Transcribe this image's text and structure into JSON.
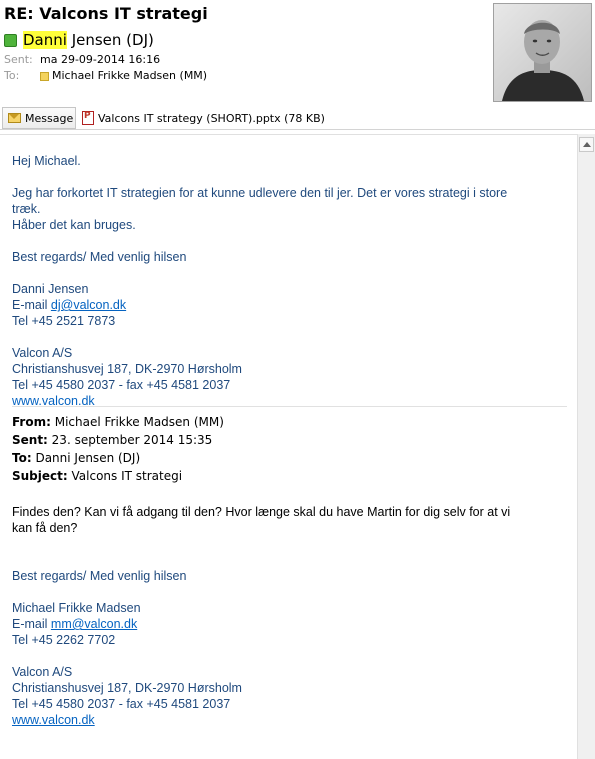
{
  "message": {
    "subject": "RE: Valcons IT strategi",
    "sender_highlight": "Danni",
    "sender_rest": " Jensen (DJ)",
    "sent_label": "Sent:",
    "sent_value": "ma 29-09-2014 16:16",
    "to_label": "To:",
    "to_value": "Michael Frikke Madsen (MM)"
  },
  "attachments": {
    "message_tab": "Message",
    "file": "Valcons IT strategy (SHORT).pptx (78 KB)"
  },
  "body": {
    "greeting": "Hej Michael.",
    "para1_line1": "Jeg har forkortet IT strategien for at kunne udlevere den til jer. Det er vores strategi i store",
    "para1_line2": "træk.",
    "para1_line3": "Håber det kan bruges.",
    "regards": "Best regards/ Med venlig hilsen",
    "sig1_name": "Danni Jensen",
    "sig1_email_prefix": "E-mail ",
    "sig1_email": "dj@valcon.dk",
    "sig1_tel": "Tel +45 2521 7873",
    "company": "Valcon A/S",
    "address": "Christianshusvej 187, DK-2970 Hørsholm",
    "tel_fax": "Tel +45 4580 2037 - fax +45 4581 2037",
    "website": "www.valcon.dk"
  },
  "quoted": {
    "from_label": "From:",
    "from_value": " Michael Frikke Madsen (MM)",
    "sent_label": "Sent:",
    "sent_value": " 23. september 2014 15:35",
    "to_label": "To:",
    "to_value": " Danni Jensen (DJ)",
    "subject_label": "Subject:",
    "subject_value": " Valcons IT strategi",
    "text_line1": "Findes den? Kan vi få adgang til den? Hvor længe skal du have Martin for dig selv for at vi",
    "text_line2": "kan få den?",
    "regards": "Best regards/ Med venlig hilsen",
    "sig_name": "Michael Frikke Madsen",
    "sig_email_prefix": "E-mail ",
    "sig_email": "mm@valcon.dk",
    "sig_tel": "Tel +45 2262 7702",
    "company": "Valcon A/S",
    "address": "Christianshusvej 187, DK-2970 Hørsholm",
    "tel_fax": "Tel +45 4580 2037 - fax +45 4581 2037",
    "website": "www.valcon.dk"
  },
  "colors": {
    "body_text": "#1f497d",
    "link": "#0563c1",
    "highlight": "#ffff3a",
    "presence": "#4fb33b"
  }
}
